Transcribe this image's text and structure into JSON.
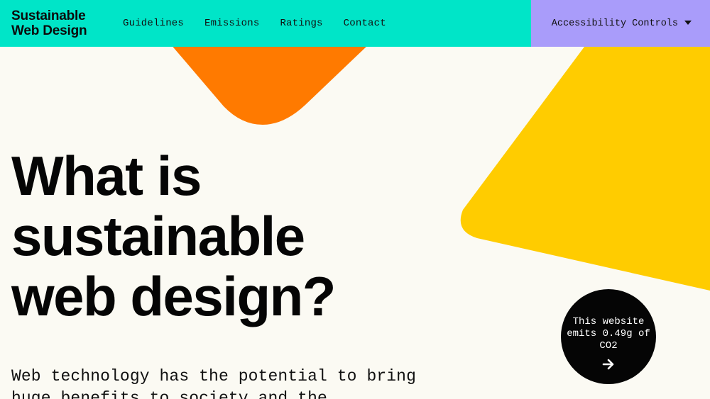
{
  "header": {
    "logo": {
      "line1": "Sustainable",
      "line2": "Web Design"
    },
    "nav": [
      {
        "label": "Guidelines"
      },
      {
        "label": "Emissions"
      },
      {
        "label": "Ratings"
      },
      {
        "label": "Contact"
      }
    ],
    "accessibility": {
      "label": "Accessibility Controls",
      "icon": "caret-down-icon"
    }
  },
  "hero": {
    "title_lines": [
      "What is",
      "sustainable",
      "web design?"
    ],
    "intro": "Web technology has the potential to bring huge benefits to society and the"
  },
  "badge": {
    "text": "This website emits 0.49g of CO2",
    "icon": "arrow-right-icon"
  },
  "colors": {
    "nav_bg": "#00e5c8",
    "access_bg": "#a99cfa",
    "page_bg": "#fbfaf3",
    "orange": "#ff7a00",
    "yellow": "#ffcc00",
    "text": "#0b0b0b"
  }
}
